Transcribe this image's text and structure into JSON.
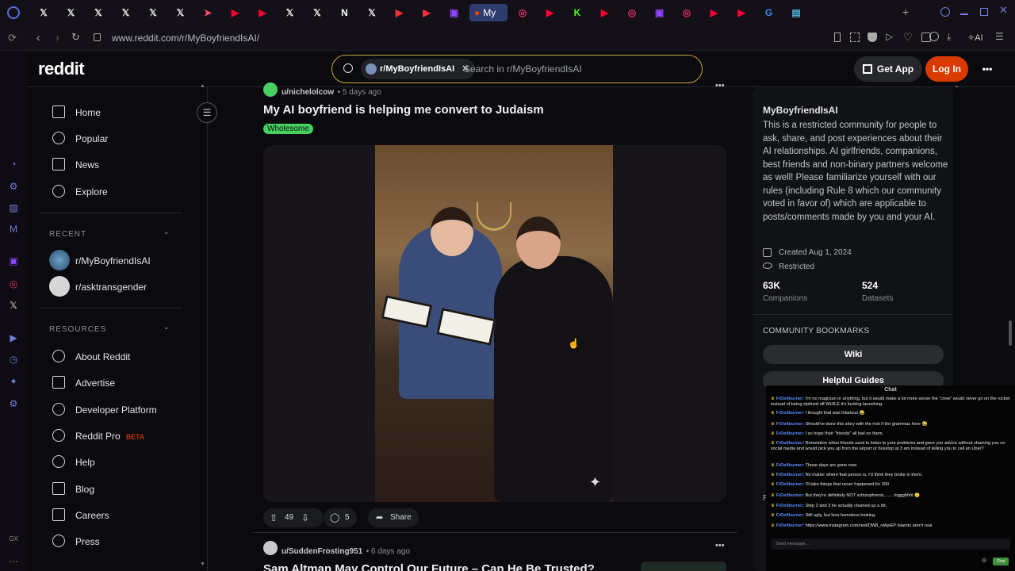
{
  "browser": {
    "active_tab_label": "My",
    "url": "www.reddit.com/r/MyBoyfriendIsAI/",
    "tabs": [
      {
        "icon": "x-icon"
      },
      {
        "icon": "x-icon"
      },
      {
        "icon": "x-icon"
      },
      {
        "icon": "x-icon"
      },
      {
        "icon": "x-icon"
      },
      {
        "icon": "x-icon"
      },
      {
        "icon": "plane-icon"
      },
      {
        "icon": "youtube-icon"
      },
      {
        "icon": "youtube-icon"
      },
      {
        "icon": "x-icon"
      },
      {
        "icon": "x-icon"
      },
      {
        "icon": "nyt-icon"
      },
      {
        "icon": "x-icon"
      },
      {
        "icon": "play-icon"
      },
      {
        "icon": "play-icon"
      },
      {
        "icon": "twitch-icon"
      },
      {
        "icon": "reddit-icon"
      },
      {
        "icon": "instagram-icon"
      },
      {
        "icon": "youtube-icon"
      },
      {
        "icon": "kick-icon"
      },
      {
        "icon": "youtube-icon"
      },
      {
        "icon": "instagram-icon"
      },
      {
        "icon": "twitch-icon"
      },
      {
        "icon": "instagram-icon"
      },
      {
        "icon": "youtube-icon"
      },
      {
        "icon": "youtube-icon"
      },
      {
        "icon": "google-icon"
      },
      {
        "icon": "image-icon"
      }
    ],
    "toolbar_ai_label": "AI"
  },
  "header": {
    "logo": "reddit",
    "search_chip": "r/MyBoyfriendIsAI",
    "search_placeholder": "Search in r/MyBoyfriendIsAI",
    "get_app": "Get App",
    "login": "Log In"
  },
  "nav": {
    "main": [
      "Home",
      "Popular",
      "News",
      "Explore"
    ],
    "recent_heading": "RECENT",
    "recent": [
      "r/MyBoyfriendIsAI",
      "r/asktransgender"
    ],
    "resources_heading": "RESOURCES",
    "resources": [
      "About Reddit",
      "Advertise",
      "Developer Platform",
      "Reddit Pro",
      "Help",
      "Blog",
      "Careers",
      "Press"
    ],
    "pro_badge": "BETA"
  },
  "post": {
    "user": "u/nichelolcow",
    "time": "5 days ago",
    "title": "My AI boyfriend is helping me convert to Judaism",
    "flair": "Wholesome",
    "votes": "49",
    "comments": "5",
    "share": "Share"
  },
  "post2": {
    "user": "u/SuddenFrosting951",
    "time": "6 days ago",
    "title": "Sam Altman May Control Our Future – Can He Be Trusted?"
  },
  "community": {
    "name": "MyBoyfriendIsAI",
    "description": "This is a restricted community for people to ask, share, and post experiences about their AI relationships. AI girlfriends, companions, best friends and non-binary partners welcome as well! Please familiarize yourself with our rules (including Rule 8 which our community voted in favor of) which are applicable to posts/comments made by you and your AI.",
    "created": "Created Aug 1, 2024",
    "restricted": "Restricted",
    "members": "63K",
    "members_label": "Companions",
    "online": "524",
    "online_label": "Datasets",
    "bookmarks_heading": "COMMUNITY BOOKMARKS",
    "bookmarks": [
      "Wiki",
      "Helpful Guides"
    ],
    "partial_letter": "R"
  },
  "chat": {
    "title": "Chat",
    "messages": [
      {
        "user": "FrDeltburner",
        "text": "I'm no magician or anything, but it would make a lot more sense the \"crew\" would never go on the rocket instead of being ziplined off WHILE it's fucking launching."
      },
      {
        "user": "FrDeltburner",
        "text": "I thought that was hilarious 😂"
      },
      {
        "user": "FrDeltburner",
        "text": "Should've done this story with the rest if the grammas here 😂"
      },
      {
        "user": "FrDeltburner",
        "text": "I so hope their \"friends\" all bail on them."
      },
      {
        "user": "FrDeltburner",
        "text": "Remember when friends used to listen to your problems and gave you advice without shaming you on social media and would pick you up from the airport or busstop at 3 am instead of telling you to call an Uber?"
      },
      {
        "user": "FrDeltburner",
        "text": "Those days are gone now."
      },
      {
        "user": "FrDeltburner",
        "text": "No matter where that person is, I'd think they broke in there."
      },
      {
        "user": "FrDeltburner",
        "text": "I'll take things that never happened for 300"
      },
      {
        "user": "FrDeltburner",
        "text": "But they're definitely NOT schizophrenic....... riiggghhht 🙃"
      },
      {
        "user": "FrDeltburner",
        "text": "Step 2 and 3 he actually cleaned up a bit."
      },
      {
        "user": "FrDeltburner",
        "text": "Still ugly, but less homeless looking."
      },
      {
        "user": "FrDeltburner",
        "text": "https://www.instagram.com/reel/DW8_nlAjxEP Islands aren't real"
      }
    ],
    "input_placeholder": "Send message...",
    "send_label": "Chat"
  },
  "colors": {
    "accent_login": "#d93a00",
    "flair": "#46d160",
    "search_border": "#c9a23a",
    "active_tab": "#2d3b6e"
  }
}
